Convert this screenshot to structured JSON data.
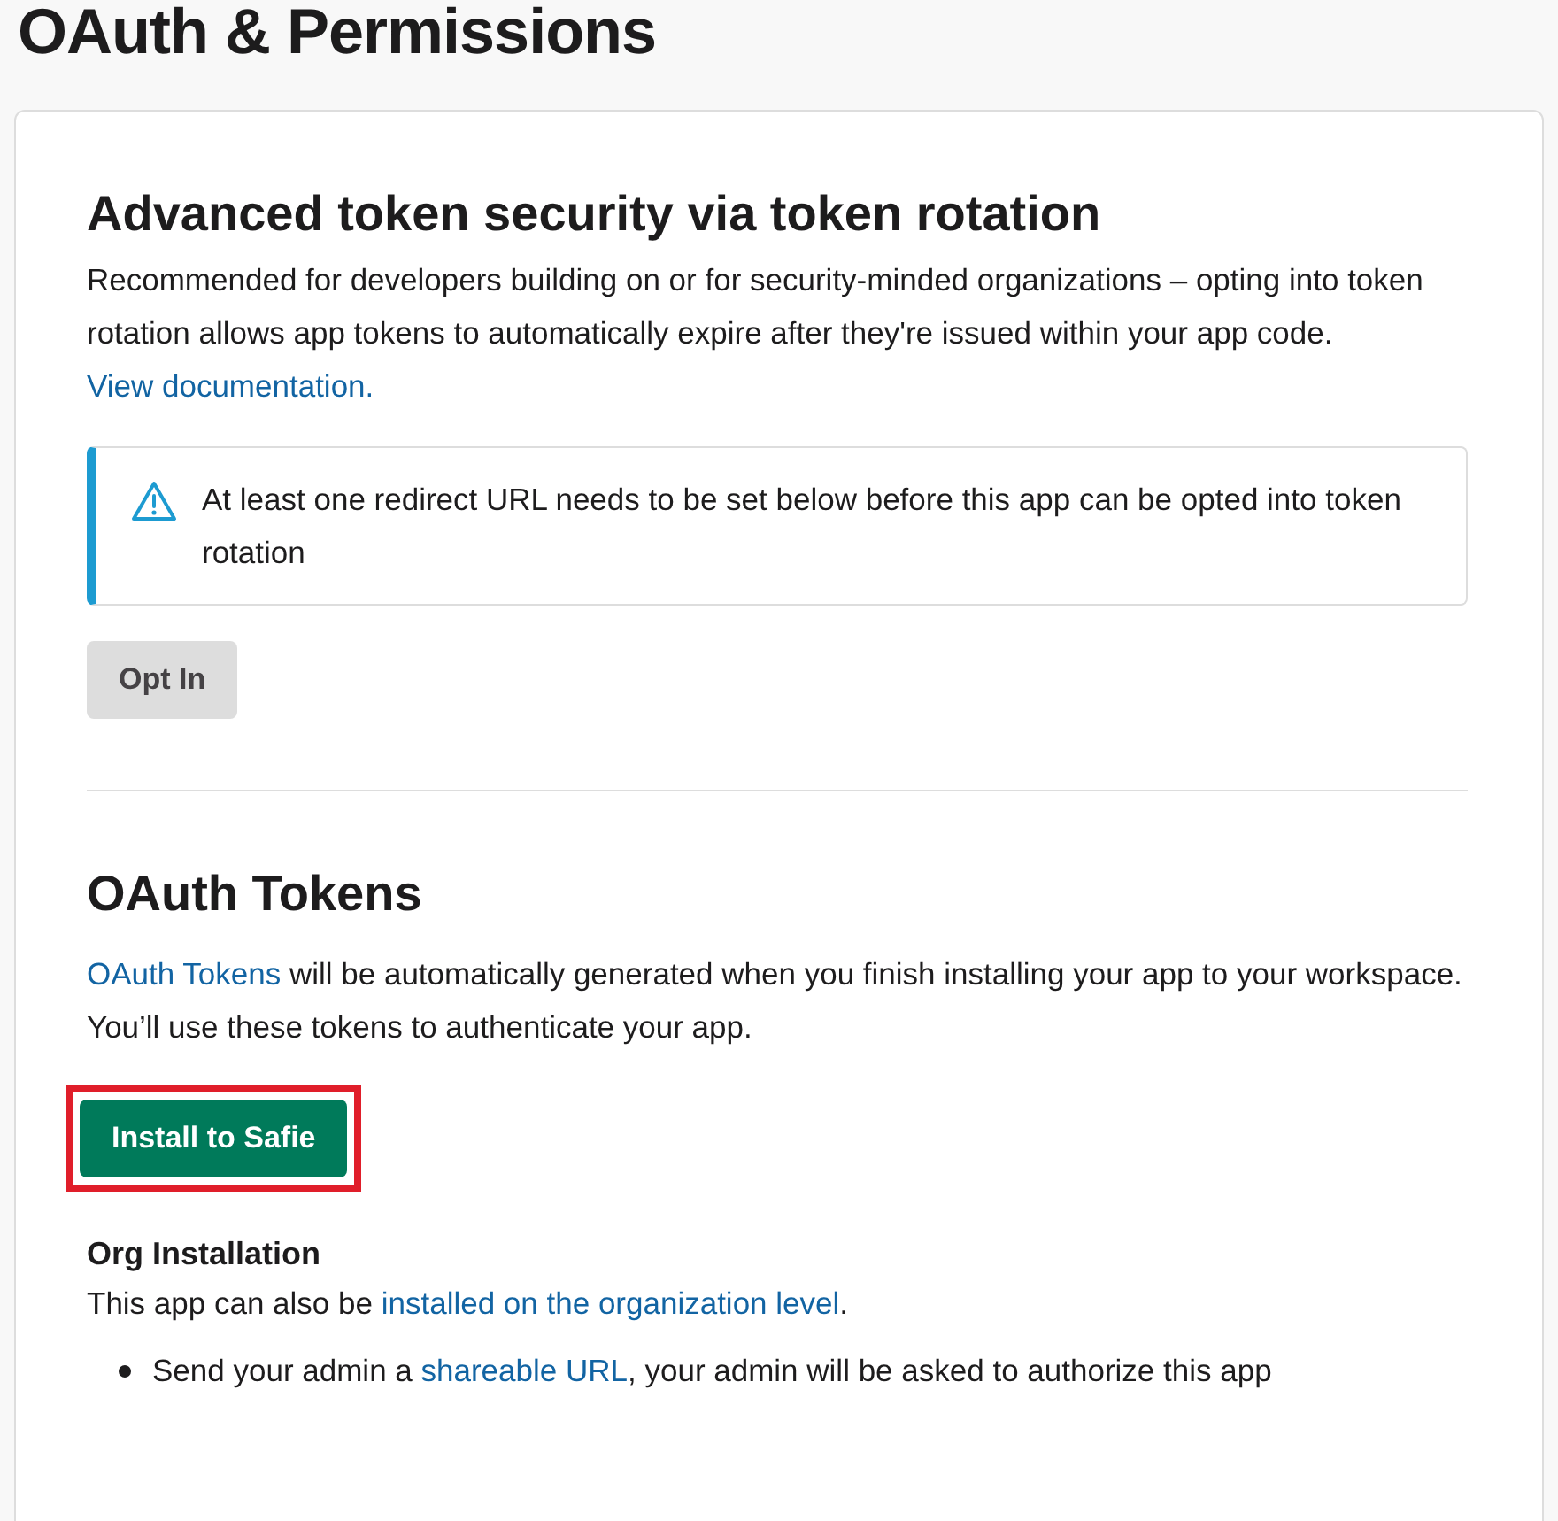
{
  "page_title": "OAuth & Permissions",
  "token_rotation": {
    "heading": "Advanced token security via token rotation",
    "description": [
      {
        "kind": "text",
        "text": "Recommended for developers building on or for security-minded organizations – opting into token rotation allows app tokens to automatically expire after they're issued within your app code. "
      },
      {
        "kind": "link",
        "text": "View documentation."
      }
    ],
    "notice": {
      "text": "At least one redirect URL needs to be set below before this app can be opted into token rotation"
    },
    "button": {
      "label": "Opt In",
      "disabled": true
    }
  },
  "oauth_tokens": {
    "heading": "OAuth Tokens",
    "description": [
      {
        "kind": "link",
        "text": "OAuth Tokens"
      },
      {
        "kind": "text",
        "text": " will be automatically generated when you finish installing your app to your workspace. You’ll use these tokens to authenticate your app."
      }
    ],
    "button": {
      "label": "Install to Safie",
      "highlighted": true
    },
    "org_installation": {
      "heading": "Org Installation",
      "description": [
        {
          "kind": "text",
          "text": "This app can also be "
        },
        {
          "kind": "link",
          "text": "installed on the organization level"
        },
        {
          "kind": "text",
          "text": "."
        }
      ],
      "bullets": [
        [
          {
            "kind": "text",
            "text": "Send your admin a "
          },
          {
            "kind": "link",
            "text": "shareable URL"
          },
          {
            "kind": "text",
            "text": ", your admin will be asked to authorize this app"
          }
        ]
      ]
    }
  }
}
